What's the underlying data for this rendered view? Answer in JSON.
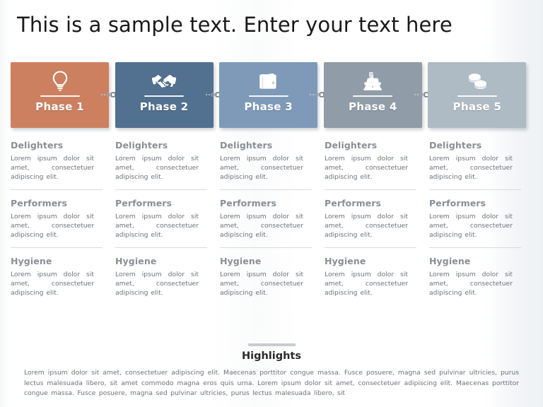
{
  "slide": {
    "title": "This is a sample text. Enter your text here"
  },
  "phases": [
    {
      "label": "Phase 1",
      "icon": "lightbulb-icon",
      "color": "#CC8060"
    },
    {
      "label": "Phase 2",
      "icon": "handshake-icon",
      "color": "#52708F"
    },
    {
      "label": "Phase 3",
      "icon": "wallet-icon",
      "color": "#7E9AB8"
    },
    {
      "label": "Phase 4",
      "icon": "cash-register-icon",
      "color": "#909CA8"
    },
    {
      "label": "Phase 5",
      "icon": "coins-icon",
      "color": "#AEBAC4"
    }
  ],
  "blocks": [
    {
      "title": "Delighters",
      "body": "Lorem ipsum dolor sit amet, consectetuer adipiscing elit."
    },
    {
      "title": "Performers",
      "body": "Lorem ipsum dolor sit amet, consectetuer adipiscing elit."
    },
    {
      "title": "Hygiene",
      "body": "Lorem ipsum dolor sit amet, consectetuer adipiscing elit."
    }
  ],
  "highlights": {
    "title": "Highlights",
    "body": "Lorem ipsum dolor sit amet, consectetuer adipiscing elit. Maecenas porttitor congue massa. Fusce posuere, magna sed pulvinar ultricies, purus lectus malesuada libero, sit amet commodo magna eros quis urna. Lorem ipsum dolor sit amet, consectetuer adipiscing elit. Maecenas porttitor congue massa. Fusce posuere, magna sed pulvinar ultricies, purus lectus malesuada libero, sit"
  },
  "colors": {
    "title_text": "#1a1a1a",
    "block_title": "#8a8f96",
    "block_body": "#6d7279",
    "divider": "#d8dbdf",
    "highlight_rule": "#c8cbcf"
  }
}
